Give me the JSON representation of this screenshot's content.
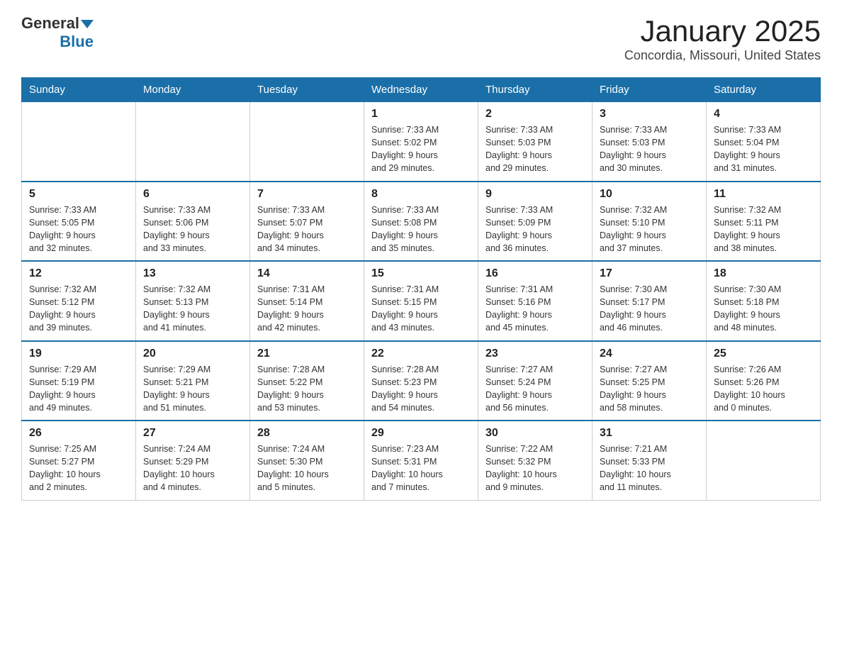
{
  "header": {
    "logo_general": "General",
    "logo_blue": "Blue",
    "title": "January 2025",
    "location": "Concordia, Missouri, United States"
  },
  "days_of_week": [
    "Sunday",
    "Monday",
    "Tuesday",
    "Wednesday",
    "Thursday",
    "Friday",
    "Saturday"
  ],
  "weeks": [
    [
      {
        "day": "",
        "info": ""
      },
      {
        "day": "",
        "info": ""
      },
      {
        "day": "",
        "info": ""
      },
      {
        "day": "1",
        "info": "Sunrise: 7:33 AM\nSunset: 5:02 PM\nDaylight: 9 hours\nand 29 minutes."
      },
      {
        "day": "2",
        "info": "Sunrise: 7:33 AM\nSunset: 5:03 PM\nDaylight: 9 hours\nand 29 minutes."
      },
      {
        "day": "3",
        "info": "Sunrise: 7:33 AM\nSunset: 5:03 PM\nDaylight: 9 hours\nand 30 minutes."
      },
      {
        "day": "4",
        "info": "Sunrise: 7:33 AM\nSunset: 5:04 PM\nDaylight: 9 hours\nand 31 minutes."
      }
    ],
    [
      {
        "day": "5",
        "info": "Sunrise: 7:33 AM\nSunset: 5:05 PM\nDaylight: 9 hours\nand 32 minutes."
      },
      {
        "day": "6",
        "info": "Sunrise: 7:33 AM\nSunset: 5:06 PM\nDaylight: 9 hours\nand 33 minutes."
      },
      {
        "day": "7",
        "info": "Sunrise: 7:33 AM\nSunset: 5:07 PM\nDaylight: 9 hours\nand 34 minutes."
      },
      {
        "day": "8",
        "info": "Sunrise: 7:33 AM\nSunset: 5:08 PM\nDaylight: 9 hours\nand 35 minutes."
      },
      {
        "day": "9",
        "info": "Sunrise: 7:33 AM\nSunset: 5:09 PM\nDaylight: 9 hours\nand 36 minutes."
      },
      {
        "day": "10",
        "info": "Sunrise: 7:32 AM\nSunset: 5:10 PM\nDaylight: 9 hours\nand 37 minutes."
      },
      {
        "day": "11",
        "info": "Sunrise: 7:32 AM\nSunset: 5:11 PM\nDaylight: 9 hours\nand 38 minutes."
      }
    ],
    [
      {
        "day": "12",
        "info": "Sunrise: 7:32 AM\nSunset: 5:12 PM\nDaylight: 9 hours\nand 39 minutes."
      },
      {
        "day": "13",
        "info": "Sunrise: 7:32 AM\nSunset: 5:13 PM\nDaylight: 9 hours\nand 41 minutes."
      },
      {
        "day": "14",
        "info": "Sunrise: 7:31 AM\nSunset: 5:14 PM\nDaylight: 9 hours\nand 42 minutes."
      },
      {
        "day": "15",
        "info": "Sunrise: 7:31 AM\nSunset: 5:15 PM\nDaylight: 9 hours\nand 43 minutes."
      },
      {
        "day": "16",
        "info": "Sunrise: 7:31 AM\nSunset: 5:16 PM\nDaylight: 9 hours\nand 45 minutes."
      },
      {
        "day": "17",
        "info": "Sunrise: 7:30 AM\nSunset: 5:17 PM\nDaylight: 9 hours\nand 46 minutes."
      },
      {
        "day": "18",
        "info": "Sunrise: 7:30 AM\nSunset: 5:18 PM\nDaylight: 9 hours\nand 48 minutes."
      }
    ],
    [
      {
        "day": "19",
        "info": "Sunrise: 7:29 AM\nSunset: 5:19 PM\nDaylight: 9 hours\nand 49 minutes."
      },
      {
        "day": "20",
        "info": "Sunrise: 7:29 AM\nSunset: 5:21 PM\nDaylight: 9 hours\nand 51 minutes."
      },
      {
        "day": "21",
        "info": "Sunrise: 7:28 AM\nSunset: 5:22 PM\nDaylight: 9 hours\nand 53 minutes."
      },
      {
        "day": "22",
        "info": "Sunrise: 7:28 AM\nSunset: 5:23 PM\nDaylight: 9 hours\nand 54 minutes."
      },
      {
        "day": "23",
        "info": "Sunrise: 7:27 AM\nSunset: 5:24 PM\nDaylight: 9 hours\nand 56 minutes."
      },
      {
        "day": "24",
        "info": "Sunrise: 7:27 AM\nSunset: 5:25 PM\nDaylight: 9 hours\nand 58 minutes."
      },
      {
        "day": "25",
        "info": "Sunrise: 7:26 AM\nSunset: 5:26 PM\nDaylight: 10 hours\nand 0 minutes."
      }
    ],
    [
      {
        "day": "26",
        "info": "Sunrise: 7:25 AM\nSunset: 5:27 PM\nDaylight: 10 hours\nand 2 minutes."
      },
      {
        "day": "27",
        "info": "Sunrise: 7:24 AM\nSunset: 5:29 PM\nDaylight: 10 hours\nand 4 minutes."
      },
      {
        "day": "28",
        "info": "Sunrise: 7:24 AM\nSunset: 5:30 PM\nDaylight: 10 hours\nand 5 minutes."
      },
      {
        "day": "29",
        "info": "Sunrise: 7:23 AM\nSunset: 5:31 PM\nDaylight: 10 hours\nand 7 minutes."
      },
      {
        "day": "30",
        "info": "Sunrise: 7:22 AM\nSunset: 5:32 PM\nDaylight: 10 hours\nand 9 minutes."
      },
      {
        "day": "31",
        "info": "Sunrise: 7:21 AM\nSunset: 5:33 PM\nDaylight: 10 hours\nand 11 minutes."
      },
      {
        "day": "",
        "info": ""
      }
    ]
  ]
}
